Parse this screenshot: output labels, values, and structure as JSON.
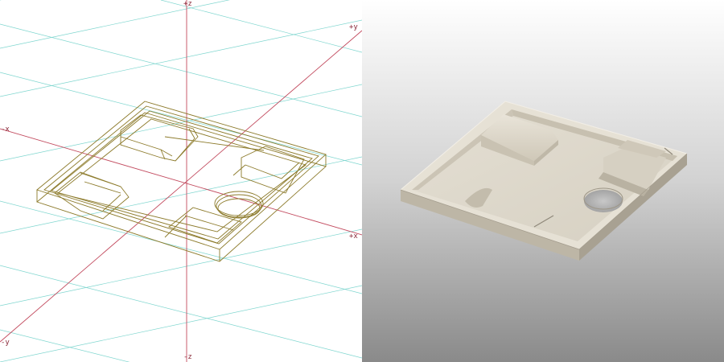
{
  "wireframe_view": {
    "axis_labels": {
      "pos_z": "+z",
      "neg_z": "-z",
      "pos_y": "+y",
      "neg_y": "-y",
      "pos_x": "+x",
      "neg_x": "-x"
    },
    "icon": "tray-wireframe-icon"
  },
  "shaded_view": {
    "icon": "tray-shaded-icon"
  },
  "colors": {
    "axis": "#b4334a",
    "grid": "#6fd0c8",
    "wire": "#8c7a2a",
    "model": "#dcd6c8"
  }
}
